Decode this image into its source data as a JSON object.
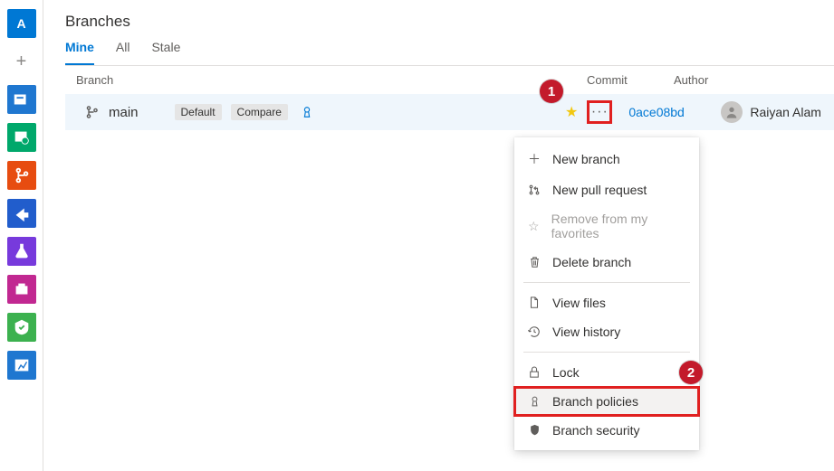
{
  "page": {
    "title": "Branches"
  },
  "pivot": {
    "items": [
      {
        "label": "Mine",
        "selected": true
      },
      {
        "label": "All",
        "selected": false
      },
      {
        "label": "Stale",
        "selected": false
      }
    ]
  },
  "columns": {
    "branch": "Branch",
    "commit": "Commit",
    "author": "Author"
  },
  "row": {
    "name": "main",
    "tags": {
      "default": "Default",
      "compare": "Compare"
    },
    "commit": "0ace08bd",
    "author": "Raiyan Alam"
  },
  "menu": {
    "new_branch": "New branch",
    "new_pr": "New pull request",
    "remove_fav": "Remove from my favorites",
    "delete_branch": "Delete branch",
    "view_files": "View files",
    "view_history": "View history",
    "lock": "Lock",
    "branch_policies": "Branch policies",
    "branch_security": "Branch security"
  },
  "callouts": {
    "one": "1",
    "two": "2"
  },
  "rail": {
    "avatar_letter": "A"
  }
}
